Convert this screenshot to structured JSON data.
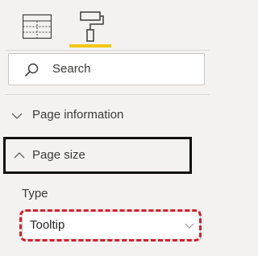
{
  "toolbar": {
    "tools": [
      {
        "icon": "fields-grid-icon",
        "selected": false
      },
      {
        "icon": "format-paint-roller-icon",
        "selected": true
      }
    ],
    "accent_color": "#f2c811"
  },
  "search": {
    "placeholder": "Search"
  },
  "sections": {
    "page_information": {
      "label": "Page information",
      "expanded": false
    },
    "page_size": {
      "label": "Page size",
      "expanded": true,
      "type_label": "Type",
      "type_value": "Tooltip"
    }
  },
  "annotations": {
    "page_size_box_color": "#111111",
    "type_dropdown_highlight_color": "#d2202f"
  }
}
